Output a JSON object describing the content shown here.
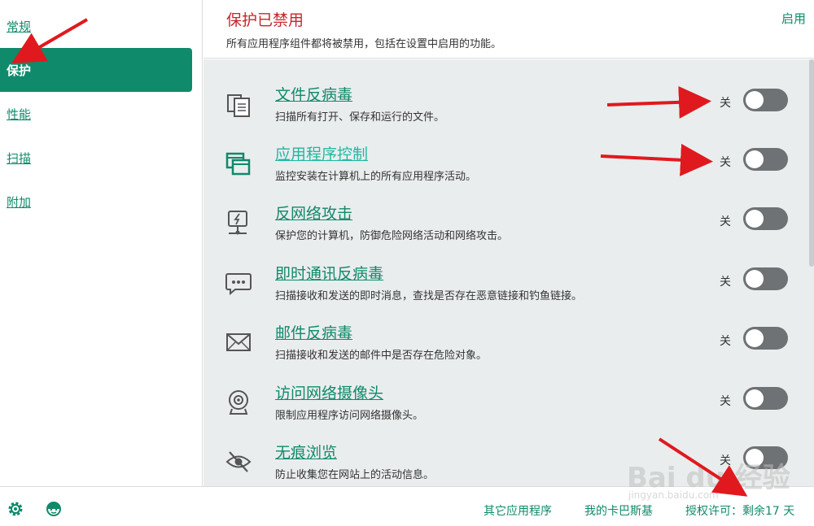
{
  "sidebar": {
    "items": [
      {
        "label": "常规"
      },
      {
        "label": "保护"
      },
      {
        "label": "性能"
      },
      {
        "label": "扫描"
      },
      {
        "label": "附加"
      }
    ]
  },
  "header": {
    "title": "保护已禁用",
    "subtitle": "所有应用程序组件都将被禁用，包括在设置中启用的功能。",
    "enable_label": "启用"
  },
  "components": [
    {
      "name": "文件反病毒",
      "desc": "扫描所有打开、保存和运行的文件。",
      "state": "关",
      "icon": "file-copy-icon"
    },
    {
      "name": "应用程序控制",
      "desc": "监控安装在计算机上的所有应用程序活动。",
      "state": "关",
      "icon": "app-windows-icon"
    },
    {
      "name": "反网络攻击",
      "desc": "保护您的计算机，防御危险网络活动和网络攻击。",
      "state": "关",
      "icon": "network-monitor-icon"
    },
    {
      "name": "即时通讯反病毒",
      "desc": "扫描接收和发送的即时消息，查找是否存在恶意链接和钓鱼链接。",
      "state": "关",
      "icon": "chat-bubble-icon"
    },
    {
      "name": "邮件反病毒",
      "desc": "扫描接收和发送的邮件中是否存在危险对象。",
      "state": "关",
      "icon": "envelope-icon"
    },
    {
      "name": "访问网络摄像头",
      "desc": "限制应用程序访问网络摄像头。",
      "state": "关",
      "icon": "webcam-icon"
    },
    {
      "name": "无痕浏览",
      "desc": "防止收集您在网站上的活动信息。",
      "state": "关",
      "icon": "eye-slash-icon"
    }
  ],
  "footer": {
    "other_apps": "其它应用程序",
    "my_kaspersky": "我的卡巴斯基",
    "license": "授权许可：剩余17 天"
  },
  "watermark": {
    "text": "Bai du 经验",
    "sub": "jingyan.baidu.com"
  },
  "colors": {
    "accent": "#0f8a6a",
    "danger": "#c7252c",
    "list_bg": "#eaedee",
    "toggle_off": "#6e7275",
    "arrow": "#e0191e"
  }
}
